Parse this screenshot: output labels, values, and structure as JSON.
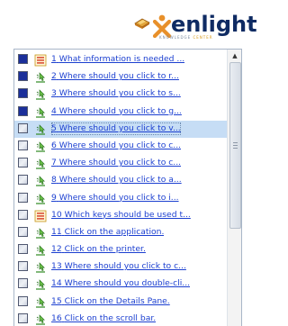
{
  "header": {
    "logo_text": "enlight",
    "logo_tagline": "KNOWLEDGE",
    "logo_tagline_accent": "CENTER",
    "brand_colors": {
      "orange": "#e8902a",
      "navy": "#0f2b63"
    }
  },
  "question_list": {
    "items": [
      {
        "number": "1",
        "text": "What information is needed ...",
        "status": "answered",
        "icon": "checklist-icon"
      },
      {
        "number": "2",
        "text": "Where should you click to r...",
        "status": "answered",
        "icon": "pointer-click-icon"
      },
      {
        "number": "3",
        "text": "Where should you click to s...",
        "status": "answered",
        "icon": "pointer-click-icon"
      },
      {
        "number": "4",
        "text": "Where should you click to g...",
        "status": "answered",
        "icon": "pointer-click-icon"
      },
      {
        "number": "5",
        "text": "Where should you click to v...",
        "status": "current",
        "icon": "pointer-click-icon"
      },
      {
        "number": "6",
        "text": "Where should you click to c...",
        "status": "unanswered",
        "icon": "pointer-click-icon"
      },
      {
        "number": "7",
        "text": "Where should you click to c...",
        "status": "unanswered",
        "icon": "pointer-click-icon"
      },
      {
        "number": "8",
        "text": "Where should you click to a...",
        "status": "unanswered",
        "icon": "pointer-click-icon"
      },
      {
        "number": "9",
        "text": "Where should you click to i...",
        "status": "unanswered",
        "icon": "pointer-click-icon"
      },
      {
        "number": "10",
        "text": "Which keys should be used t...",
        "status": "unanswered",
        "icon": "checklist-icon"
      },
      {
        "number": "11",
        "text": "Click on the application.",
        "status": "unanswered",
        "icon": "pointer-click-icon"
      },
      {
        "number": "12",
        "text": "Click on the printer.",
        "status": "unanswered",
        "icon": "pointer-click-icon"
      },
      {
        "number": "13",
        "text": "Where should you click to c...",
        "status": "unanswered",
        "icon": "pointer-click-icon"
      },
      {
        "number": "14",
        "text": "Where should you double-cli...",
        "status": "unanswered",
        "icon": "pointer-click-icon"
      },
      {
        "number": "15",
        "text": "Click on the Details Pane.",
        "status": "unanswered",
        "icon": "pointer-click-icon"
      },
      {
        "number": "16",
        "text": "Click on the scroll bar.",
        "status": "unanswered",
        "icon": "pointer-click-icon"
      }
    ]
  },
  "scrollbar": {
    "up_arrow_icon": "scroll-up-arrow-icon",
    "position": 0
  }
}
